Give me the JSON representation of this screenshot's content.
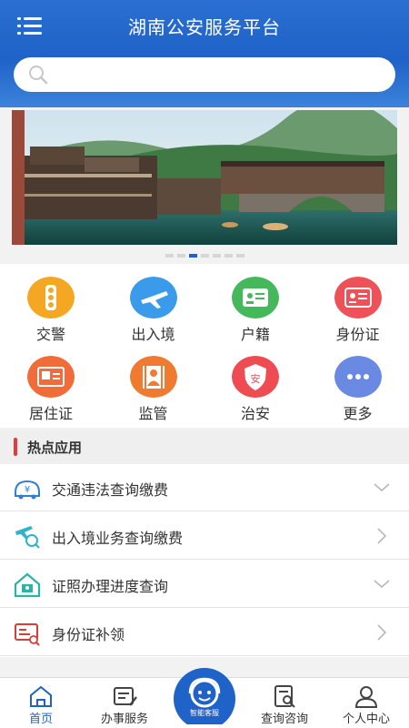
{
  "header": {
    "title": "湖南公安服务平台"
  },
  "search": {
    "placeholder": ""
  },
  "banner": {
    "slides": 7,
    "active_index": 2
  },
  "grid": [
    {
      "label": "交警",
      "icon": "traffic-light-icon",
      "color": "#f5a623"
    },
    {
      "label": "出入境",
      "icon": "airplane-icon",
      "color": "#3a9bea"
    },
    {
      "label": "户籍",
      "icon": "household-card-icon",
      "color": "#46b85c"
    },
    {
      "label": "身份证",
      "icon": "id-card-icon",
      "color": "#ee5157"
    },
    {
      "label": "居住证",
      "icon": "residence-card-icon",
      "color": "#f26b3a"
    },
    {
      "label": "监管",
      "icon": "supervision-icon",
      "color": "#f07b30"
    },
    {
      "label": "治安",
      "icon": "security-shield-icon",
      "color": "#ee4b52"
    },
    {
      "label": "更多",
      "icon": "more-icon",
      "color": "#6a89e3"
    }
  ],
  "hot": {
    "title": "热点应用",
    "items": [
      {
        "label": "交通违法查询缴费",
        "icon": "car-fine-icon",
        "arrow": "chevron-down"
      },
      {
        "label": "出入境业务查询缴费",
        "icon": "plane-search-icon",
        "arrow": "chevron-right"
      },
      {
        "label": "证照办理进度查询",
        "icon": "house-icon",
        "arrow": "chevron-down"
      },
      {
        "label": "身份证补领",
        "icon": "id-reissue-icon",
        "arrow": "chevron-right"
      }
    ]
  },
  "tabs": [
    {
      "label": "首页",
      "icon": "home-icon",
      "active": true
    },
    {
      "label": "办事服务",
      "icon": "service-icon",
      "active": false
    },
    {
      "label": "查询咨询",
      "icon": "query-icon",
      "active": false
    },
    {
      "label": "个人中心",
      "icon": "user-icon",
      "active": false
    }
  ],
  "customer_service": {
    "label": "智能客服",
    "icon": "customer-service-icon"
  },
  "colors": {
    "primary": "#1f62c8",
    "accent_red": "#e53a36"
  }
}
